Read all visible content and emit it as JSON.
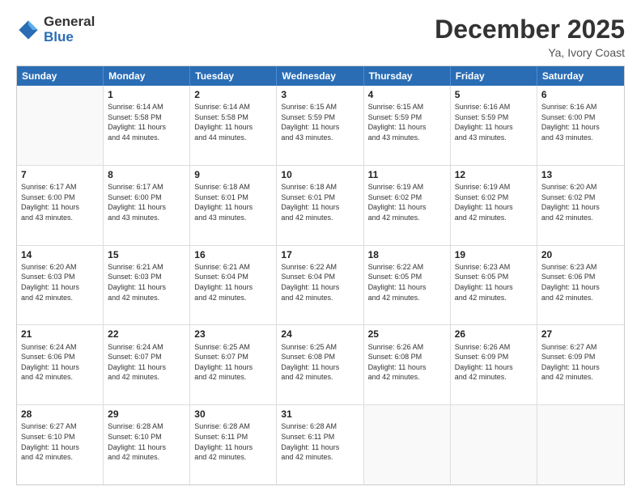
{
  "logo": {
    "general": "General",
    "blue": "Blue"
  },
  "title": {
    "month": "December 2025",
    "location": "Ya, Ivory Coast"
  },
  "calendar": {
    "headers": [
      "Sunday",
      "Monday",
      "Tuesday",
      "Wednesday",
      "Thursday",
      "Friday",
      "Saturday"
    ],
    "rows": [
      [
        {
          "day": "",
          "info": ""
        },
        {
          "day": "1",
          "info": "Sunrise: 6:14 AM\nSunset: 5:58 PM\nDaylight: 11 hours\nand 44 minutes."
        },
        {
          "day": "2",
          "info": "Sunrise: 6:14 AM\nSunset: 5:58 PM\nDaylight: 11 hours\nand 44 minutes."
        },
        {
          "day": "3",
          "info": "Sunrise: 6:15 AM\nSunset: 5:59 PM\nDaylight: 11 hours\nand 43 minutes."
        },
        {
          "day": "4",
          "info": "Sunrise: 6:15 AM\nSunset: 5:59 PM\nDaylight: 11 hours\nand 43 minutes."
        },
        {
          "day": "5",
          "info": "Sunrise: 6:16 AM\nSunset: 5:59 PM\nDaylight: 11 hours\nand 43 minutes."
        },
        {
          "day": "6",
          "info": "Sunrise: 6:16 AM\nSunset: 6:00 PM\nDaylight: 11 hours\nand 43 minutes."
        }
      ],
      [
        {
          "day": "7",
          "info": "Sunrise: 6:17 AM\nSunset: 6:00 PM\nDaylight: 11 hours\nand 43 minutes."
        },
        {
          "day": "8",
          "info": "Sunrise: 6:17 AM\nSunset: 6:00 PM\nDaylight: 11 hours\nand 43 minutes."
        },
        {
          "day": "9",
          "info": "Sunrise: 6:18 AM\nSunset: 6:01 PM\nDaylight: 11 hours\nand 43 minutes."
        },
        {
          "day": "10",
          "info": "Sunrise: 6:18 AM\nSunset: 6:01 PM\nDaylight: 11 hours\nand 42 minutes."
        },
        {
          "day": "11",
          "info": "Sunrise: 6:19 AM\nSunset: 6:02 PM\nDaylight: 11 hours\nand 42 minutes."
        },
        {
          "day": "12",
          "info": "Sunrise: 6:19 AM\nSunset: 6:02 PM\nDaylight: 11 hours\nand 42 minutes."
        },
        {
          "day": "13",
          "info": "Sunrise: 6:20 AM\nSunset: 6:02 PM\nDaylight: 11 hours\nand 42 minutes."
        }
      ],
      [
        {
          "day": "14",
          "info": "Sunrise: 6:20 AM\nSunset: 6:03 PM\nDaylight: 11 hours\nand 42 minutes."
        },
        {
          "day": "15",
          "info": "Sunrise: 6:21 AM\nSunset: 6:03 PM\nDaylight: 11 hours\nand 42 minutes."
        },
        {
          "day": "16",
          "info": "Sunrise: 6:21 AM\nSunset: 6:04 PM\nDaylight: 11 hours\nand 42 minutes."
        },
        {
          "day": "17",
          "info": "Sunrise: 6:22 AM\nSunset: 6:04 PM\nDaylight: 11 hours\nand 42 minutes."
        },
        {
          "day": "18",
          "info": "Sunrise: 6:22 AM\nSunset: 6:05 PM\nDaylight: 11 hours\nand 42 minutes."
        },
        {
          "day": "19",
          "info": "Sunrise: 6:23 AM\nSunset: 6:05 PM\nDaylight: 11 hours\nand 42 minutes."
        },
        {
          "day": "20",
          "info": "Sunrise: 6:23 AM\nSunset: 6:06 PM\nDaylight: 11 hours\nand 42 minutes."
        }
      ],
      [
        {
          "day": "21",
          "info": "Sunrise: 6:24 AM\nSunset: 6:06 PM\nDaylight: 11 hours\nand 42 minutes."
        },
        {
          "day": "22",
          "info": "Sunrise: 6:24 AM\nSunset: 6:07 PM\nDaylight: 11 hours\nand 42 minutes."
        },
        {
          "day": "23",
          "info": "Sunrise: 6:25 AM\nSunset: 6:07 PM\nDaylight: 11 hours\nand 42 minutes."
        },
        {
          "day": "24",
          "info": "Sunrise: 6:25 AM\nSunset: 6:08 PM\nDaylight: 11 hours\nand 42 minutes."
        },
        {
          "day": "25",
          "info": "Sunrise: 6:26 AM\nSunset: 6:08 PM\nDaylight: 11 hours\nand 42 minutes."
        },
        {
          "day": "26",
          "info": "Sunrise: 6:26 AM\nSunset: 6:09 PM\nDaylight: 11 hours\nand 42 minutes."
        },
        {
          "day": "27",
          "info": "Sunrise: 6:27 AM\nSunset: 6:09 PM\nDaylight: 11 hours\nand 42 minutes."
        }
      ],
      [
        {
          "day": "28",
          "info": "Sunrise: 6:27 AM\nSunset: 6:10 PM\nDaylight: 11 hours\nand 42 minutes."
        },
        {
          "day": "29",
          "info": "Sunrise: 6:28 AM\nSunset: 6:10 PM\nDaylight: 11 hours\nand 42 minutes."
        },
        {
          "day": "30",
          "info": "Sunrise: 6:28 AM\nSunset: 6:11 PM\nDaylight: 11 hours\nand 42 minutes."
        },
        {
          "day": "31",
          "info": "Sunrise: 6:28 AM\nSunset: 6:11 PM\nDaylight: 11 hours\nand 42 minutes."
        },
        {
          "day": "",
          "info": ""
        },
        {
          "day": "",
          "info": ""
        },
        {
          "day": "",
          "info": ""
        }
      ]
    ]
  }
}
